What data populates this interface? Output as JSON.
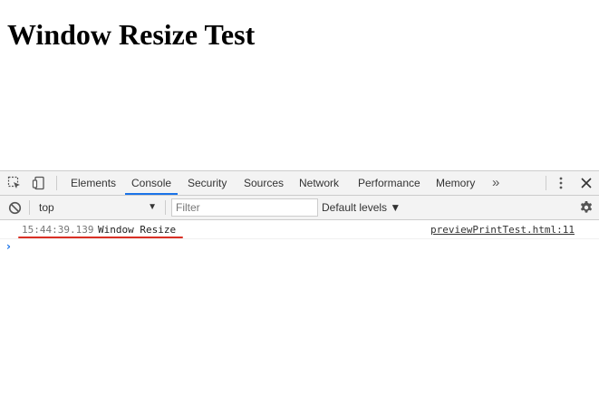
{
  "page": {
    "title": "Window Resize Test"
  },
  "devtools": {
    "tabs": [
      {
        "label": "Elements"
      },
      {
        "label": "Console"
      },
      {
        "label": "Security"
      },
      {
        "label": "Sources"
      },
      {
        "label": "Network"
      },
      {
        "label": "Performance"
      },
      {
        "label": "Memory"
      }
    ],
    "active_tab": "Console",
    "icons": {
      "inspect": "inspect-element-icon",
      "device": "device-toolbar-icon",
      "more_tabs": "chevron-double-right-icon",
      "menu": "vertical-dots-icon",
      "close": "close-icon",
      "clear": "clear-console-icon",
      "settings": "gear-icon"
    },
    "more_tabs_glyph": "»",
    "toolbar": {
      "context": "top",
      "filter_placeholder": "Filter",
      "levels": "Default levels ▼"
    },
    "console": {
      "entries": [
        {
          "timestamp": "15:44:39.139",
          "message": "Window Resize",
          "source": "previewPrintTest.html:11"
        }
      ],
      "prompt_glyph": "›"
    },
    "colors": {
      "accent": "#1a73e8",
      "highlight_underline": "#d93025",
      "toolbar_bg": "#f3f3f3"
    }
  }
}
